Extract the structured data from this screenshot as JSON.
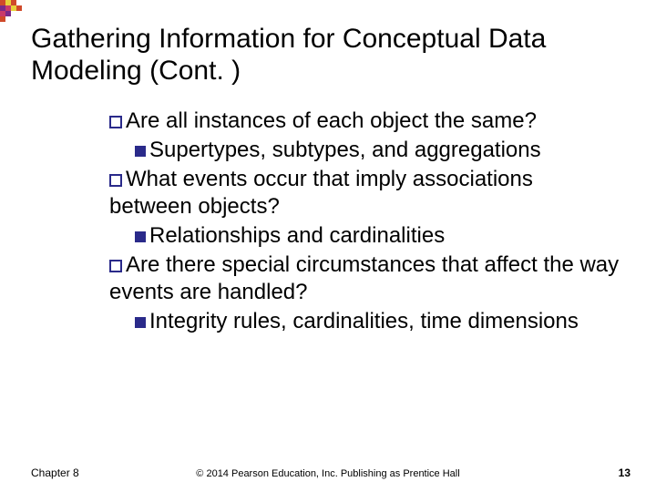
{
  "title": "Gathering Information for Conceptual Data Modeling (Cont. )",
  "bullets": {
    "q1": "Are all instances of each object the same?",
    "a1": "Supertypes, subtypes, and aggregations",
    "q2": "What events occur that imply associations between objects?",
    "a2": "Relationships and cardinalities",
    "q3": "Are there special circumstances that affect the way events are handled?",
    "a3": "Integrity rules, cardinalities, time dimensions"
  },
  "footer": {
    "left": "Chapter 8",
    "center": "© 2014 Pearson Education, Inc. Publishing as Prentice Hall",
    "right": "13"
  },
  "logo": {
    "name": "corner-mosaic-logo"
  }
}
